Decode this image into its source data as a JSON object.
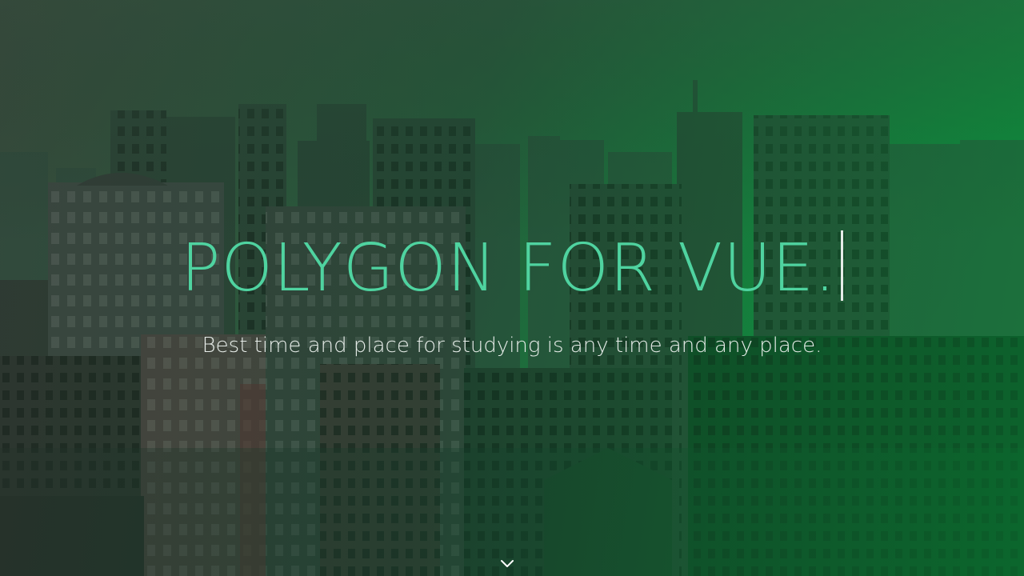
{
  "hero": {
    "title": "POLYGON FOR VUE.",
    "subtitle": "Best time and place for studying is any time and any place.",
    "title_color": "#4fd3a0",
    "cursor_color": "#e6ece8",
    "subtitle_color": "#e6ece8",
    "overlay_accent": "#0f9a46",
    "background_image": "city-skyline-photo",
    "scroll_icon": "chevron-down-icon"
  }
}
